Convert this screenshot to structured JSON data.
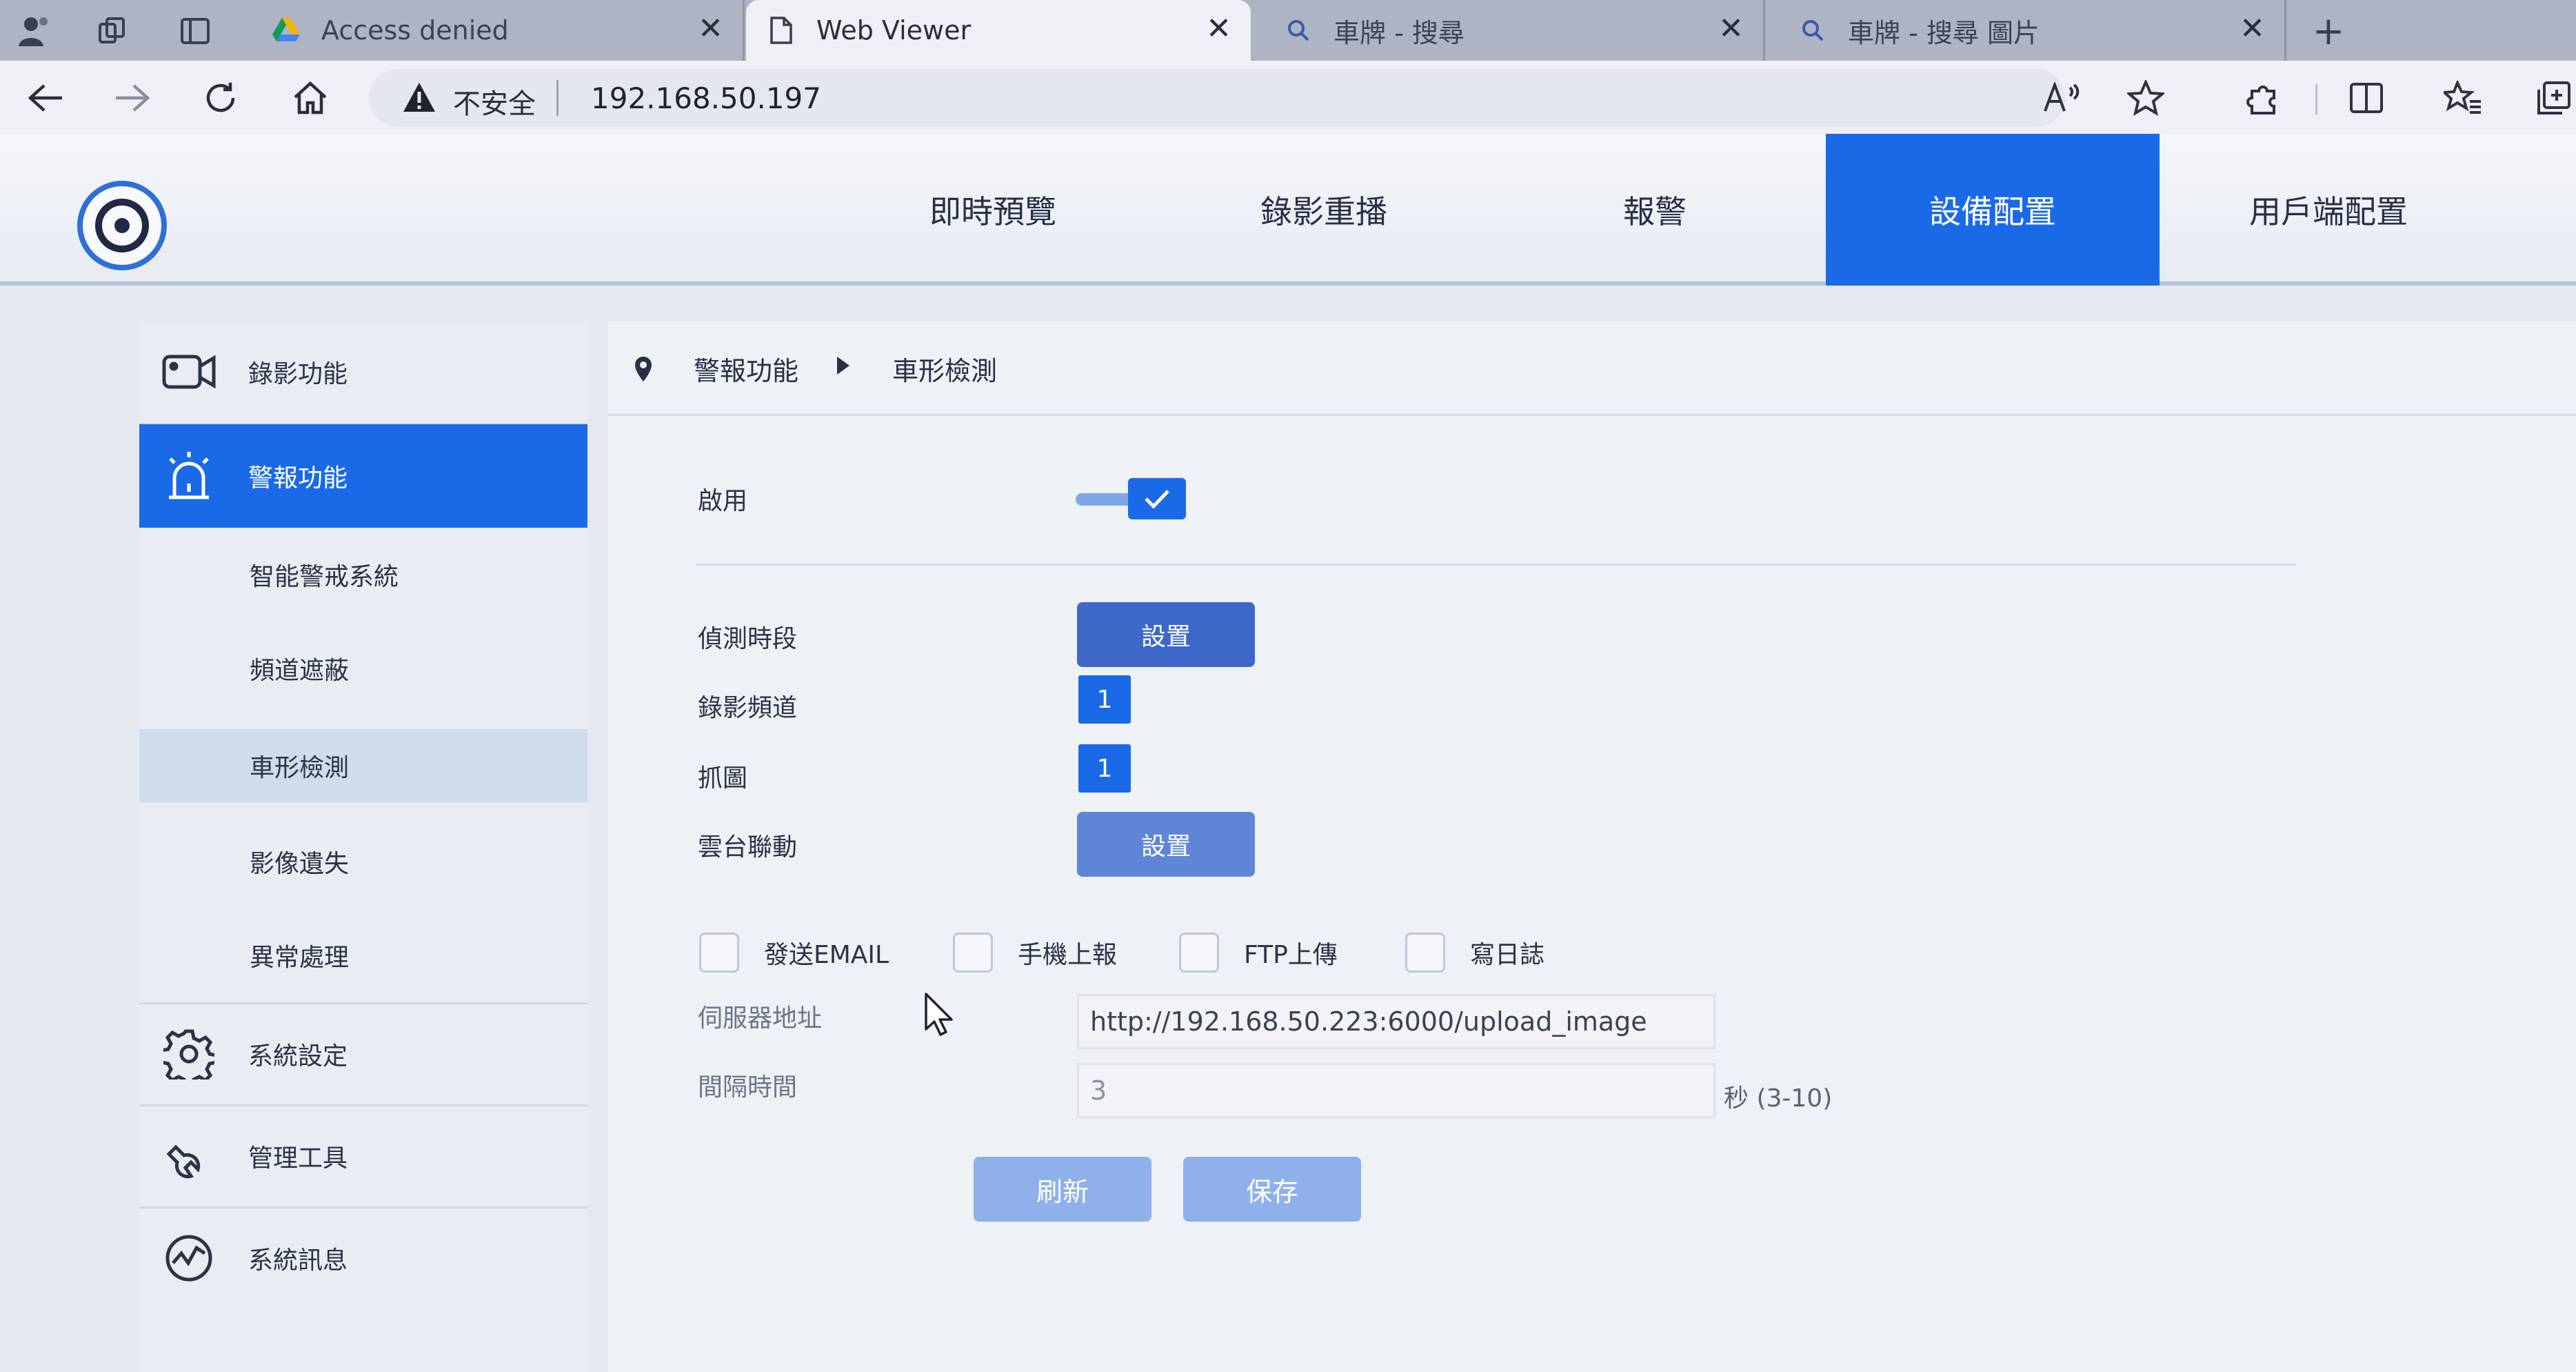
{
  "browser": {
    "tabs": [
      {
        "title": "Access denied"
      },
      {
        "title": "Web Viewer"
      },
      {
        "title": "車牌 - 搜尋"
      },
      {
        "title": "車牌 - 搜尋 圖片"
      }
    ],
    "insecure_label": "不安全",
    "url": "192.168.50.197"
  },
  "topnav": {
    "items": [
      {
        "label": "即時預覽"
      },
      {
        "label": "錄影重播"
      },
      {
        "label": "報警"
      },
      {
        "label": "設備配置"
      },
      {
        "label": "用戶端配置"
      }
    ],
    "active": "設備配置"
  },
  "sidebar": {
    "items": [
      {
        "label": "錄影功能",
        "icon": "video-camera-icon"
      },
      {
        "label": "警報功能",
        "icon": "alarm-icon"
      },
      {
        "label": "智能警戒系統"
      },
      {
        "label": "頻道遮蔽"
      },
      {
        "label": "車形檢測"
      },
      {
        "label": "影像遺失"
      },
      {
        "label": "異常處理"
      },
      {
        "label": "系統設定",
        "icon": "gear-icon"
      },
      {
        "label": "管理工具",
        "icon": "wrench-icon"
      },
      {
        "label": "系統訊息",
        "icon": "system-info-icon"
      }
    ],
    "active": "警報功能",
    "selected": "車形檢測"
  },
  "breadcrumb": {
    "parent": "警報功能",
    "current": "車形檢測"
  },
  "form": {
    "enable_label": "啟用",
    "enable_checked": true,
    "schedule_label": "偵測時段",
    "schedule_button": "設置",
    "record_channel_label": "錄影頻道",
    "record_channel_value": "1",
    "snapshot_label": "抓圖",
    "snapshot_value": "1",
    "ptz_label": "雲台聯動",
    "ptz_button": "設置",
    "checkboxes": [
      {
        "label": "發送EMAIL",
        "checked": false
      },
      {
        "label": "手機上報",
        "checked": false
      },
      {
        "label": "FTP上傳",
        "checked": false
      },
      {
        "label": "寫日誌",
        "checked": false
      }
    ],
    "server_label": "伺服器地址",
    "server_value": "http://192.168.50.223:6000/upload_image",
    "interval_label": "間隔時間",
    "interval_value": "3",
    "interval_unit": "秒 (3-10)",
    "refresh_button": "刷新",
    "save_button": "保存"
  },
  "colors": {
    "accent": "#1a6ae8",
    "button": "#3d68c9",
    "button_disabled": "#8fb0ea"
  }
}
